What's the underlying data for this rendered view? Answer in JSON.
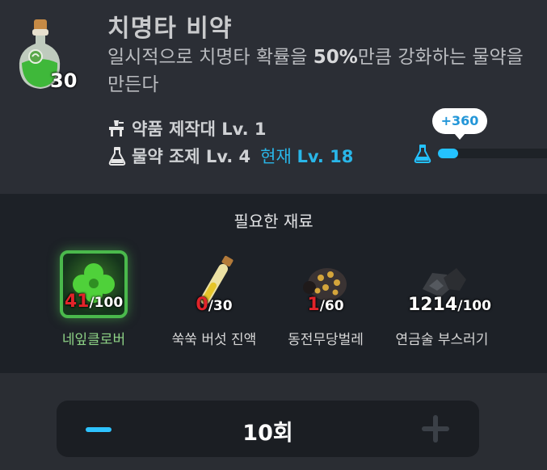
{
  "item": {
    "name": "치명타 비약",
    "count": "30",
    "description_pre": "일시적으로 치명타 확률을 ",
    "description_bold": "50%",
    "description_post": "만큼 강화하는 물약을 만든다",
    "icon": "green-potion-icon"
  },
  "requirements": {
    "workbench": {
      "label": "약품 제작대 Lv. 1",
      "icon": "workbench-icon"
    },
    "skill": {
      "label": "물약 조제 Lv. 4",
      "current_prefix": "현재 ",
      "current_level": "Lv. 18",
      "icon": "flask-icon"
    }
  },
  "experience": {
    "gain": "+360",
    "fill_fraction": 0.18,
    "color": "#24c2ff"
  },
  "materials": {
    "title": "필요한 재료",
    "items": [
      {
        "name": "네잎클로버",
        "have": "41",
        "need": "/100",
        "icon": "clover-icon",
        "sufficient": false
      },
      {
        "name": "쑥쑥 버섯 진액",
        "have": "0",
        "need": "/30",
        "icon": "vial-icon",
        "sufficient": false
      },
      {
        "name": "동전무당벌레",
        "have": "1",
        "need": "/60",
        "icon": "ladybug-icon",
        "sufficient": false
      },
      {
        "name": "연금술 부스러기",
        "have": "1214",
        "need": "/100",
        "icon": "rock-scraps-icon",
        "sufficient": true
      }
    ]
  },
  "stepper": {
    "value": "10회",
    "minus_icon": "minus-icon",
    "plus_icon": "plus-icon"
  },
  "colors": {
    "accent": "#29b6e8",
    "insufficient": "#e1242a",
    "selected_border": "#4ab94c"
  }
}
